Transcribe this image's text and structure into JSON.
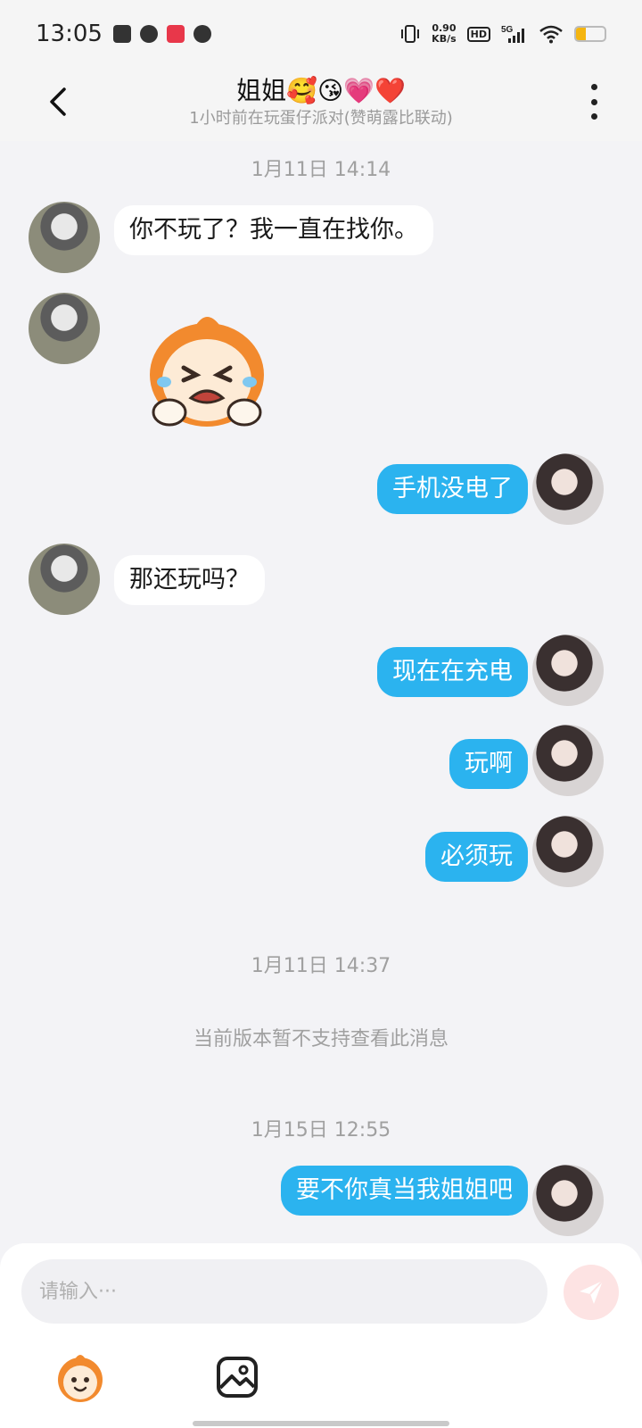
{
  "status_bar": {
    "time": "13:05",
    "net_speed_value": "0.90",
    "net_speed_unit": "KB/s",
    "hd_label": "HD",
    "network_label": "5G",
    "battery_level": 0.35,
    "battery_color": "#f5b50f"
  },
  "header": {
    "title": "姐姐🥰😘💗❤️",
    "subtitle": "1小时前在玩蛋仔派对(赞萌露比联动)"
  },
  "colors": {
    "outgoing_bubble": "#2bb3ef",
    "incoming_bubble": "#ffffff",
    "background": "#f3f3f6"
  },
  "messages": {
    "ts1": "1月11日 14:14",
    "m1": "你不玩了？我一直在找你。",
    "m3": "手机没电了",
    "m4": "那还玩吗？",
    "m5": "现在在充电",
    "m6": "玩啊",
    "m7": "必须玩",
    "ts2": "1月11日 14:37",
    "system": "当前版本暂不支持查看此消息",
    "ts3": "1月15日 12:55",
    "m8": "要不你真当我姐姐吧"
  },
  "input": {
    "placeholder": "请输入···"
  }
}
